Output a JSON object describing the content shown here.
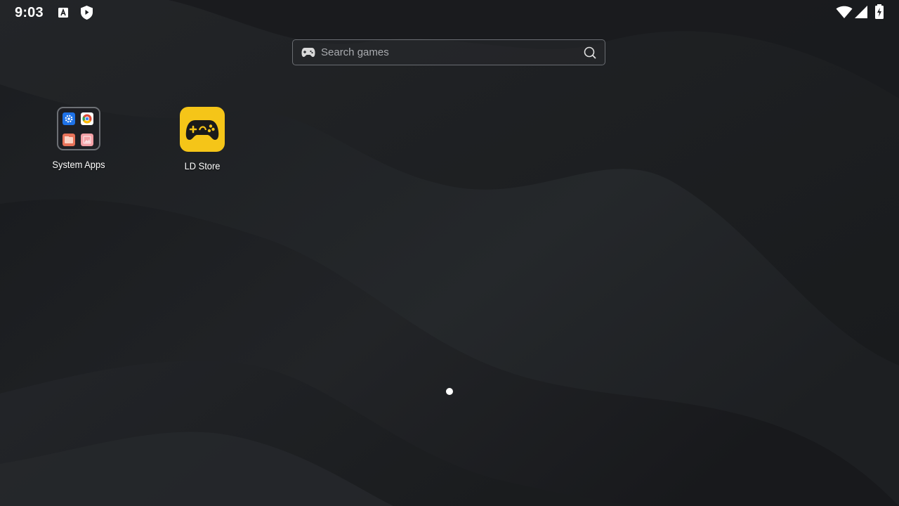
{
  "status_bar": {
    "time": "9:03",
    "left_icons": [
      "keyboard-a-icon",
      "shield-play-icon"
    ],
    "right_icons": [
      "wifi-icon",
      "cell-signal-icon",
      "battery-charging-icon"
    ]
  },
  "search": {
    "placeholder": "Search games",
    "leading_icon": "gamepad-icon",
    "trailing_icon": "search-icon"
  },
  "apps": [
    {
      "label": "System Apps",
      "type": "folder",
      "contents": [
        "settings-icon",
        "chrome-icon",
        "file-manager-icon",
        "gallery-icon"
      ]
    },
    {
      "label": "LD Store",
      "type": "app",
      "icon": "gamepad-store-icon",
      "color": "#f5c518"
    }
  ],
  "pager": {
    "pages": 1,
    "current": 1
  },
  "colors": {
    "wallpaper_base": "#1b1d20",
    "accent_yellow": "#f5c518"
  }
}
